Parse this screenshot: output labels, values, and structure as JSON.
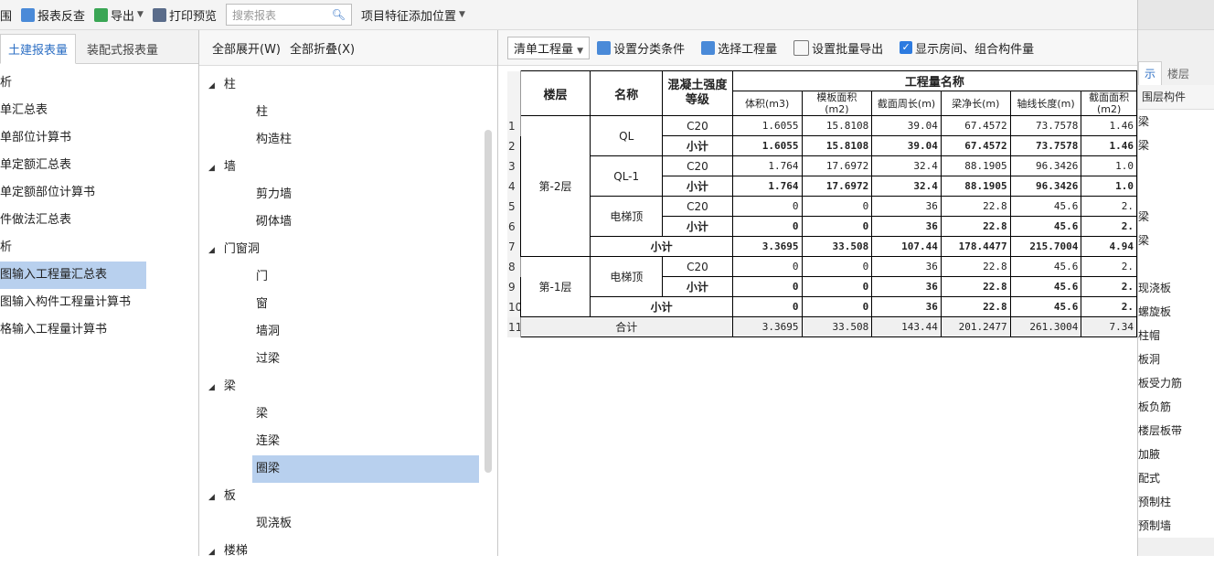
{
  "toolbar": {
    "items": [
      "围",
      "报表反查",
      "导出",
      "打印预览"
    ],
    "search_placeholder": "搜索报表",
    "feature_position": "项目特征添加位置"
  },
  "left_panel": {
    "tabs": [
      "土建报表量",
      "装配式报表量"
    ],
    "reports": [
      "析",
      "单汇总表",
      "单部位计算书",
      "单定额汇总表",
      "单定额部位计算书",
      "件做法汇总表",
      "析",
      "图输入工程量汇总表",
      "图输入构件工程量计算书",
      "格输入工程量计算书"
    ]
  },
  "middle_panel": {
    "expand_all": "全部展开(W)",
    "collapse_all": "全部折叠(X)",
    "tree": [
      {
        "type": "group",
        "label": "柱"
      },
      {
        "type": "leaf",
        "label": "柱"
      },
      {
        "type": "leaf",
        "label": "构造柱"
      },
      {
        "type": "group",
        "label": "墙"
      },
      {
        "type": "leaf",
        "label": "剪力墙"
      },
      {
        "type": "leaf",
        "label": "砌体墙"
      },
      {
        "type": "group",
        "label": "门窗洞"
      },
      {
        "type": "leaf",
        "label": "门"
      },
      {
        "type": "leaf",
        "label": "窗"
      },
      {
        "type": "leaf",
        "label": "墙洞"
      },
      {
        "type": "leaf",
        "label": "过梁"
      },
      {
        "type": "group",
        "label": "梁"
      },
      {
        "type": "leaf",
        "label": "梁"
      },
      {
        "type": "leaf",
        "label": "连梁"
      },
      {
        "type": "leaf",
        "label": "圈梁",
        "selected": true
      },
      {
        "type": "group",
        "label": "板"
      },
      {
        "type": "leaf",
        "label": "现浇板"
      },
      {
        "type": "group",
        "label": "楼梯"
      }
    ]
  },
  "right_toolbar": {
    "qty_select": "清单工程量",
    "set_classification": "设置分类条件",
    "select_quantity": "选择工程量",
    "batch_export": "设置批量导出",
    "show_rooms": "显示房间、组合构件量"
  },
  "table": {
    "headers": {
      "floor": "楼层",
      "name": "名称",
      "concrete": "混凝土强度等级",
      "quantity_group": "工程量名称",
      "columns": [
        "体积(m3)",
        "模板面积(m2)",
        "截面周长(m)",
        "梁净长(m)",
        "轴线长度(m)",
        "截面面积(m2)"
      ]
    },
    "rows": [
      {
        "n": "1",
        "grade": "C20",
        "vals": [
          "1.6055",
          "15.8108",
          "39.04",
          "67.4572",
          "73.7578",
          "1.46"
        ]
      },
      {
        "n": "2",
        "grade": "小计",
        "vals": [
          "1.6055",
          "15.8108",
          "39.04",
          "67.4572",
          "73.7578",
          "1.46"
        ]
      },
      {
        "n": "3",
        "grade": "C20",
        "vals": [
          "1.764",
          "17.6972",
          "32.4",
          "88.1905",
          "96.3426",
          "1.0"
        ]
      },
      {
        "n": "4",
        "grade": "小计",
        "vals": [
          "1.764",
          "17.6972",
          "32.4",
          "88.1905",
          "96.3426",
          "1.0"
        ]
      },
      {
        "n": "5",
        "grade": "C20",
        "vals": [
          "0",
          "0",
          "36",
          "22.8",
          "45.6",
          "2."
        ]
      },
      {
        "n": "6",
        "grade": "小计",
        "vals": [
          "0",
          "0",
          "36",
          "22.8",
          "45.6",
          "2."
        ]
      },
      {
        "n": "7",
        "grade": "小计",
        "vals": [
          "3.3695",
          "33.508",
          "107.44",
          "178.4477",
          "215.7004",
          "4.94"
        ]
      },
      {
        "n": "8",
        "grade": "C20",
        "vals": [
          "0",
          "0",
          "36",
          "22.8",
          "45.6",
          "2."
        ]
      },
      {
        "n": "9",
        "grade": "小计",
        "vals": [
          "0",
          "0",
          "36",
          "22.8",
          "45.6",
          "2."
        ]
      },
      {
        "n": "10",
        "grade": "小计",
        "vals": [
          "0",
          "0",
          "36",
          "22.8",
          "45.6",
          "2."
        ]
      },
      {
        "n": "11",
        "grade": "合计",
        "vals": [
          "3.3695",
          "33.508",
          "143.44",
          "201.2477",
          "261.3004",
          "7.34"
        ]
      }
    ],
    "floors": [
      "第-2层",
      "第-1层"
    ],
    "names": [
      "QL",
      "QL-1",
      "电梯顶",
      "电梯顶"
    ]
  },
  "right_strip": {
    "tabs": [
      "示",
      "楼层"
    ],
    "header": "围层构件",
    "items": [
      "梁",
      "梁",
      "",
      "",
      "梁",
      "梁",
      "",
      "现浇板",
      "螺旋板",
      "柱帽",
      "板洞",
      "板受力筋",
      "板负筋",
      "楼层板带",
      "加腋",
      "配式",
      "预制柱",
      "预制墙"
    ]
  }
}
